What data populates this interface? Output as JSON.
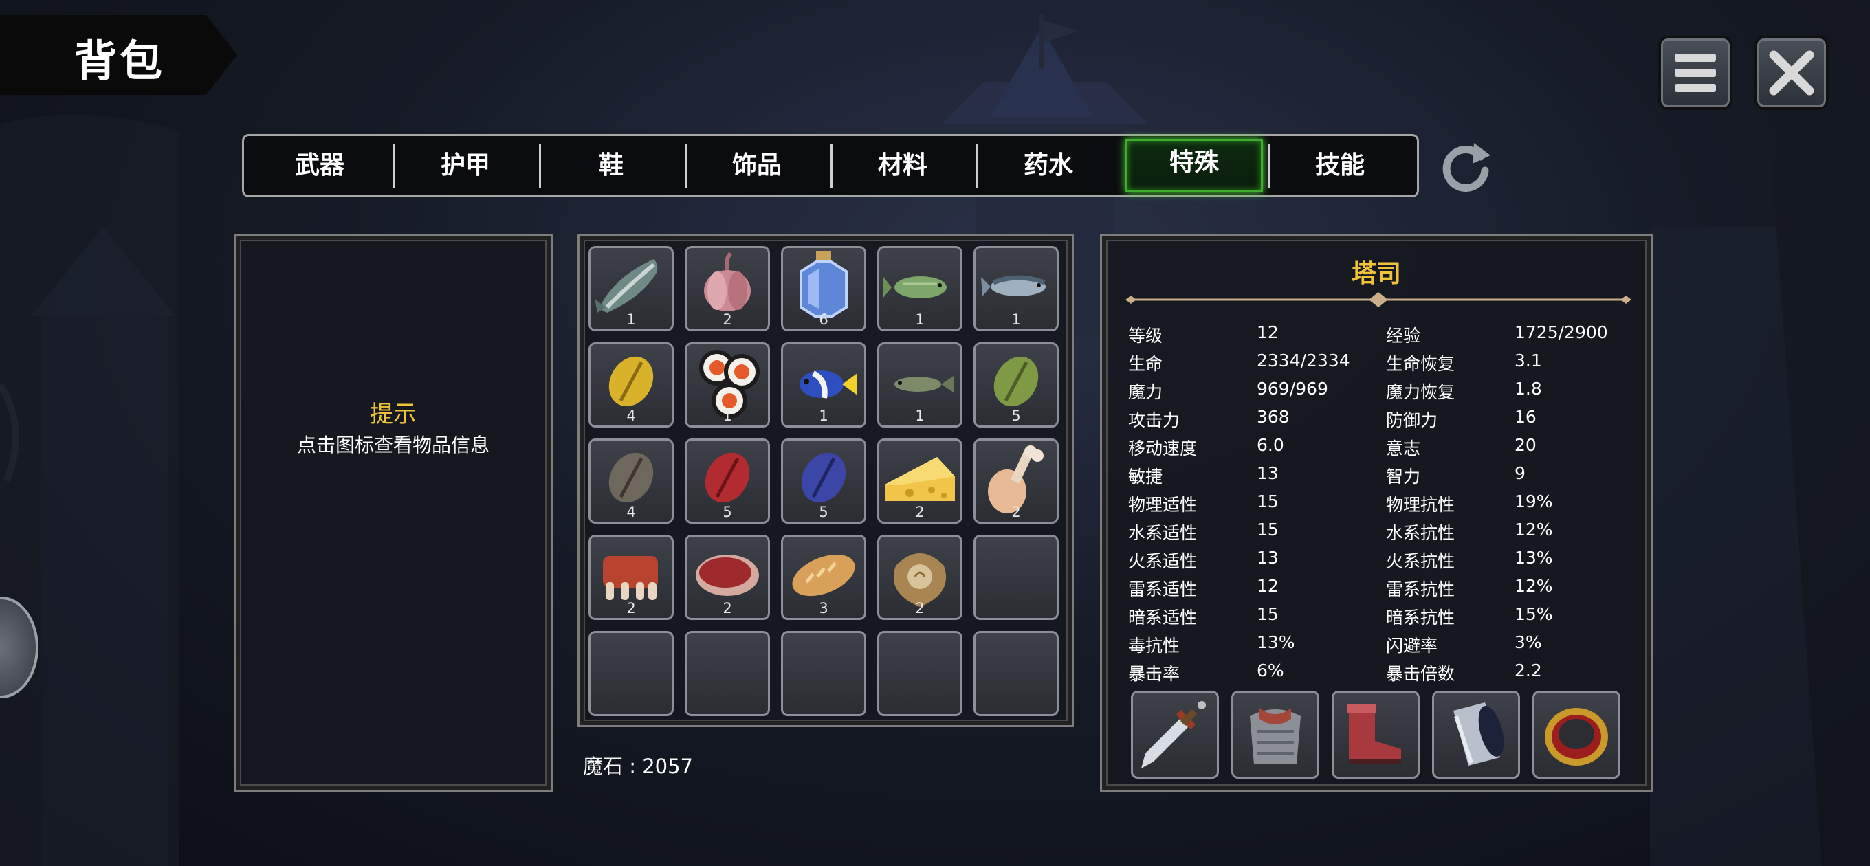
{
  "title": "背包",
  "tabs": [
    {
      "label": "武器",
      "active": false
    },
    {
      "label": "护甲",
      "active": false
    },
    {
      "label": "鞋",
      "active": false
    },
    {
      "label": "饰品",
      "active": false
    },
    {
      "label": "材料",
      "active": false
    },
    {
      "label": "药水",
      "active": false
    },
    {
      "label": "特殊",
      "active": true
    },
    {
      "label": "技能",
      "active": false
    }
  ],
  "tip": {
    "title": "提示",
    "text": "点击图标查看物品信息"
  },
  "inventory": [
    {
      "icon": "salmon-icon",
      "qty": "1"
    },
    {
      "icon": "garlic-icon",
      "qty": "2"
    },
    {
      "icon": "potion-bottle-icon",
      "qty": "6"
    },
    {
      "icon": "green-fish-icon",
      "qty": "1"
    },
    {
      "icon": "mackerel-icon",
      "qty": "1"
    },
    {
      "icon": "yellow-bean-icon",
      "qty": "4"
    },
    {
      "icon": "sushi-roll-icon",
      "qty": "1"
    },
    {
      "icon": "tropical-fish-icon",
      "qty": "1"
    },
    {
      "icon": "small-fish-icon",
      "qty": "1"
    },
    {
      "icon": "green-bean-icon",
      "qty": "5"
    },
    {
      "icon": "gray-bean-icon",
      "qty": "4"
    },
    {
      "icon": "red-bean-icon",
      "qty": "5"
    },
    {
      "icon": "blue-bean-icon",
      "qty": "5"
    },
    {
      "icon": "cheese-icon",
      "qty": "2"
    },
    {
      "icon": "chicken-leg-icon",
      "qty": "2"
    },
    {
      "icon": "ribs-icon",
      "qty": "2"
    },
    {
      "icon": "raw-meat-icon",
      "qty": "2"
    },
    {
      "icon": "bread-icon",
      "qty": "3"
    },
    {
      "icon": "flour-sack-icon",
      "qty": "2"
    },
    {
      "icon": "",
      "qty": ""
    },
    {
      "icon": "",
      "qty": ""
    },
    {
      "icon": "",
      "qty": ""
    },
    {
      "icon": "",
      "qty": ""
    },
    {
      "icon": "",
      "qty": ""
    },
    {
      "icon": "",
      "qty": ""
    }
  ],
  "currency": "魔石 : 2057",
  "character": {
    "name": "塔司",
    "stats_left": [
      {
        "label": "等级",
        "value": "12"
      },
      {
        "label": "生命",
        "value": "2334/2334"
      },
      {
        "label": "魔力",
        "value": "969/969"
      },
      {
        "label": "攻击力",
        "value": "368"
      },
      {
        "label": "移动速度",
        "value": "6.0"
      },
      {
        "label": "敏捷",
        "value": "13"
      },
      {
        "label": "物理适性",
        "value": "15"
      },
      {
        "label": "水系适性",
        "value": "15"
      },
      {
        "label": "火系适性",
        "value": "13"
      },
      {
        "label": "雷系适性",
        "value": "12"
      },
      {
        "label": "暗系适性",
        "value": "15"
      },
      {
        "label": "毒抗性",
        "value": "13%"
      },
      {
        "label": "暴击率",
        "value": "6%"
      }
    ],
    "stats_right": [
      {
        "label": "经验",
        "value": "1725/2900"
      },
      {
        "label": "生命恢复",
        "value": "3.1"
      },
      {
        "label": "魔力恢复",
        "value": "1.8"
      },
      {
        "label": "防御力",
        "value": "16"
      },
      {
        "label": "意志",
        "value": "20"
      },
      {
        "label": "智力",
        "value": "9"
      },
      {
        "label": "物理抗性",
        "value": "19%"
      },
      {
        "label": "水系抗性",
        "value": "12%"
      },
      {
        "label": "火系抗性",
        "value": "13%"
      },
      {
        "label": "雷系抗性",
        "value": "12%"
      },
      {
        "label": "暗系抗性",
        "value": "15%"
      },
      {
        "label": "闪避率",
        "value": "3%"
      },
      {
        "label": "暴击倍数",
        "value": "2.2"
      }
    ],
    "equipment": [
      "sword-icon",
      "armor-icon",
      "boots-icon",
      "bracer-icon",
      "ring-icon"
    ]
  },
  "colors": {
    "accent_gold": "#f0c43a",
    "active_tab_green": "#3fae2e"
  }
}
